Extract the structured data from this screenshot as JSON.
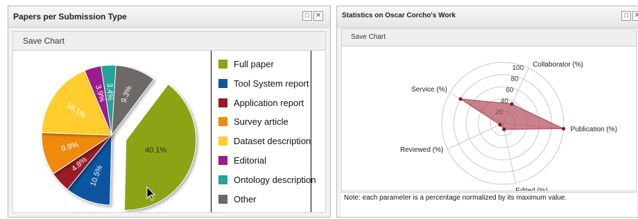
{
  "left_panel": {
    "title": "Papers per Submission Type",
    "save_chart": "Save Chart",
    "restore_glyph": "□",
    "close_glyph": "✕"
  },
  "right_panel": {
    "title": "Statistics on Oscar Corcho's Work",
    "save_chart": "Save Chart",
    "restore_glyph": "□",
    "close_glyph": "✕",
    "note": "Note: each parameter is a percentage normalized by its maximum value."
  },
  "chart_data": [
    {
      "type": "pie",
      "title": "Papers per Submission Type",
      "legend_position": "right",
      "slices": [
        {
          "name": "Full paper",
          "value": 40.1,
          "label": "40.1%",
          "color": "#8ea214",
          "exploded": true
        },
        {
          "name": "Tool System report",
          "value": 10.5,
          "label": "10.5%",
          "color": "#0f55a0"
        },
        {
          "name": "Application report",
          "value": 4.8,
          "label": "4.8%",
          "color": "#981c26"
        },
        {
          "name": "Survey article",
          "value": 9.9,
          "label": "9.9%",
          "color": "#f08a0a"
        },
        {
          "name": "Dataset description",
          "value": 18.1,
          "label": "18.1%",
          "color": "#ffce2e"
        },
        {
          "name": "Editorial",
          "value": 3.9,
          "label": "3.9%",
          "color": "#9b1c8d"
        },
        {
          "name": "Ontology description",
          "value": 3.4,
          "label": "3.4%",
          "color": "#28a296"
        },
        {
          "name": "Other",
          "value": 9.3,
          "label": "9.3%",
          "color": "#6e6866"
        }
      ]
    },
    {
      "type": "radar",
      "title": "Statistics on Oscar Corcho's Work",
      "radial_range": [
        0,
        100
      ],
      "radial_ticks": [
        "20",
        "40",
        "60",
        "80",
        "100"
      ],
      "axes": [
        "Collaborator (%)",
        "Publication (%)",
        "Edited (%)",
        "Reviewed (%)",
        "Service (%)"
      ],
      "series": [
        {
          "values": [
            35,
            100,
            10,
            5,
            80
          ],
          "color": "#b45060"
        }
      ]
    }
  ]
}
